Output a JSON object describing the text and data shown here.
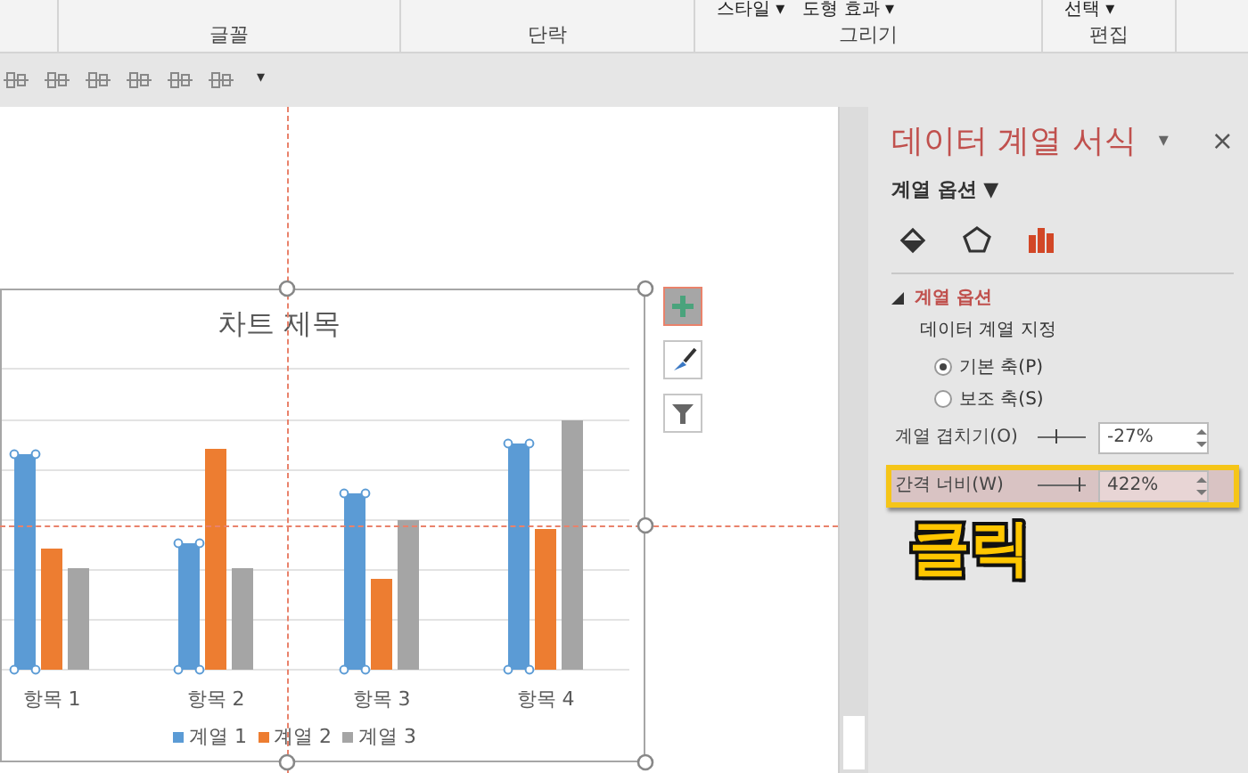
{
  "ribbon": {
    "groups": [
      {
        "label": "글꼴"
      },
      {
        "label": "단락"
      },
      {
        "label": "그리기",
        "items": [
          "스타일 ▾",
          "도형 효과 ▾"
        ]
      },
      {
        "label": "편집",
        "items": [
          "선택 ▾"
        ]
      }
    ]
  },
  "toolbar": {
    "overflow": "▾"
  },
  "chart": {
    "title": "차트 제목",
    "categories": [
      "항목 1",
      "항목 2",
      "항목 3",
      "항목 4"
    ],
    "legend": [
      {
        "label": "계열 1",
        "color": "#5b9bd5"
      },
      {
        "label": "계열 2",
        "color": "#ed7d31"
      },
      {
        "label": "계열 3",
        "color": "#a5a5a5"
      }
    ],
    "side_buttons": [
      {
        "kind": "add",
        "selected": true
      },
      {
        "kind": "style",
        "selected": false
      },
      {
        "kind": "filter",
        "selected": false
      }
    ]
  },
  "pane": {
    "title": "데이터 계열 서식",
    "menu": "▾",
    "close": "×",
    "subtitle": "계열 옵션 ▼",
    "tabs": [
      {
        "kind": "fill",
        "selected": false
      },
      {
        "kind": "effects",
        "selected": false
      },
      {
        "kind": "series",
        "selected": true
      }
    ],
    "section": {
      "title": "계열 옵션",
      "expanded": true,
      "label": "데이터 계열 지정",
      "radios": [
        {
          "label": "기본 축(P)",
          "selected": true
        },
        {
          "label": "보조 축(S)",
          "selected": false
        }
      ],
      "spinners": [
        {
          "label": "계열 겹치기(O)",
          "level": 0.37,
          "value": "-27%",
          "highlighted": false
        },
        {
          "label": "간격 너비(W)",
          "level": 0.84,
          "value": "422%",
          "highlighted": true
        }
      ]
    }
  },
  "callout": "클릭"
}
